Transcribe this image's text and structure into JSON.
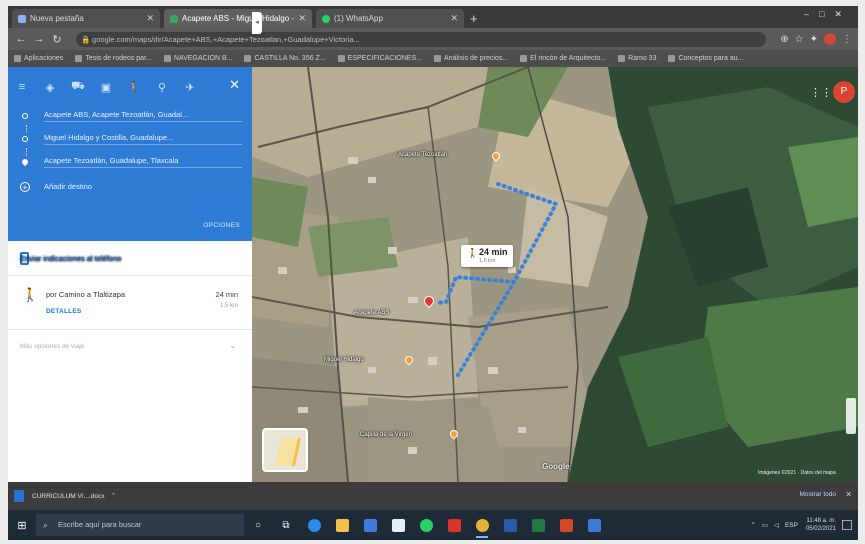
{
  "browser": {
    "tabs": [
      {
        "label": "Nueva pestaña",
        "icon": "globe-icon",
        "color": "#8ab4f8",
        "active": false
      },
      {
        "label": "Acapete ABS - Miguel Hidalgo - Google Maps",
        "icon": "google-maps-icon",
        "color": "#34a853",
        "active": true
      },
      {
        "label": "(1) WhatsApp",
        "icon": "whatsapp-icon",
        "color": "#25d366",
        "active": false
      }
    ],
    "new_tab_label": "+",
    "address": "google.com/maps/dir/Acapete+ABS,+Acapete+Tezoatlan,+Guadalupe+Victoria...",
    "bookmarks": [
      "Aplicaciones",
      "Tesis de rodeos par...",
      "NAVEGACION B...",
      "CASTILLA No. 356 Z...",
      "ESPECIFICACIONES...",
      "Análisis de precios...",
      "El rincón de Arquitecto...",
      "Ramo 33",
      "Conceptos para au..."
    ]
  },
  "directions": {
    "modes": [
      "route-icon",
      "car-icon",
      "transit-icon",
      "walk-icon",
      "bike-icon",
      "plane-icon"
    ],
    "stops": [
      "Acapete ABS, Acapete Tezoatlán, Guadal...",
      "Miguel Hidalgo y Costilla, Guadalupe...",
      "Acapete Tezoatlán, Guadalupe, Tlaxcala"
    ],
    "add_destination": "Añadir destino",
    "options_label": "OPCIONES",
    "send_to_phone": "Enviar indicaciones al teléfono",
    "route": {
      "via": "por Camino a Tlaltizapa",
      "duration": "24 min",
      "distance": "1.5 km",
      "details_label": "DETALLES"
    },
    "more_options": "Más opciones de viaje"
  },
  "map": {
    "bubble": {
      "duration": "24 min",
      "distance": "1.5 km"
    },
    "labels": [
      "Acapete Tezoatlán",
      "Acapete ABS",
      "Miguel Hidalgo",
      "Capilla de la Virgen"
    ],
    "watermark": "Google",
    "footer": "Imágenes ©2021 · Datos del mapa",
    "profile_initial": "P",
    "route_color": "#3b82d6"
  },
  "downloads": {
    "file": "CURRICULUM VI....docx",
    "show_all": "Mostrar todo"
  },
  "taskbar": {
    "search_placeholder": "Escribe aquí para buscar",
    "apps": [
      "task-view-icon",
      "edge-icon",
      "file-explorer-icon",
      "store-icon",
      "mail-icon",
      "whatsapp-icon",
      "acrobat-icon",
      "chrome-icon",
      "word-icon",
      "excel-icon",
      "powerpoint-icon",
      "photos-icon"
    ],
    "tray_lang": "ESP",
    "time": "11:48 a. m.",
    "date": "05/02/2021"
  }
}
